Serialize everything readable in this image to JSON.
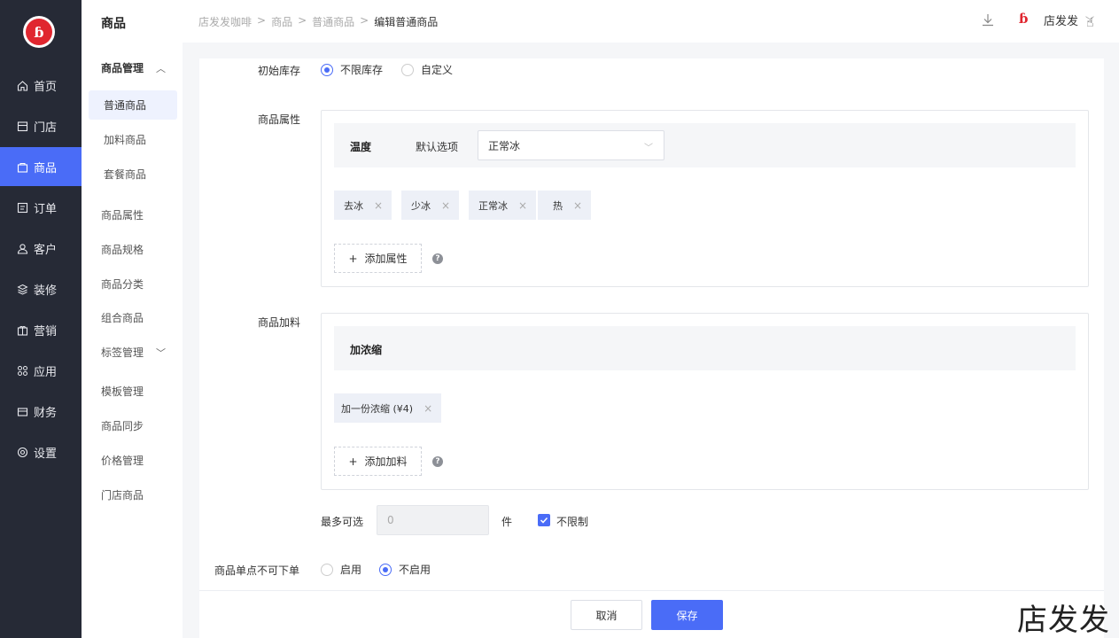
{
  "rail": {
    "items": [
      {
        "label": "首页",
        "icon": "home-icon"
      },
      {
        "label": "门店",
        "icon": "store-icon"
      },
      {
        "label": "商品",
        "icon": "bag-icon",
        "active": true
      },
      {
        "label": "订单",
        "icon": "order-icon"
      },
      {
        "label": "客户",
        "icon": "user-icon"
      },
      {
        "label": "装修",
        "icon": "layers-icon"
      },
      {
        "label": "营销",
        "icon": "gift-icon"
      },
      {
        "label": "应用",
        "icon": "apps-icon"
      },
      {
        "label": "财务",
        "icon": "wallet-icon"
      },
      {
        "label": "设置",
        "icon": "gear-icon"
      }
    ]
  },
  "sidebar": {
    "title": "商品",
    "group_manage": "商品管理",
    "sub": [
      "普通商品",
      "加料商品",
      "套餐商品"
    ],
    "items": [
      "商品属性",
      "商品规格",
      "商品分类",
      "组合商品"
    ],
    "group_tags": "标签管理",
    "items2": [
      "模板管理",
      "商品同步",
      "价格管理",
      "门店商品"
    ]
  },
  "header": {
    "breadcrumb": [
      "店发发咖啡",
      "商品",
      "普通商品",
      "编辑普通商品"
    ],
    "separator": ">",
    "user_name": "店发发"
  },
  "form": {
    "stock": {
      "label": "初始库存",
      "opt1": "不限库存",
      "opt2": "自定义"
    },
    "attr": {
      "label": "商品属性",
      "name": "温度",
      "default_label": "默认选项",
      "default_value": "正常冰",
      "tags": [
        "去冰",
        "少冰",
        "正常冰",
        "热"
      ],
      "add_label": "添加属性",
      "help": "?"
    },
    "addon": {
      "label": "商品加料",
      "name": "加浓缩",
      "tags": [
        "加一份浓缩 (¥4)"
      ],
      "add_label": "添加加料",
      "help": "?"
    },
    "max": {
      "label": "最多可选",
      "placeholder": "0",
      "unit": "件",
      "unlimited": "不限制"
    },
    "single": {
      "label": "商品单点不可下单",
      "opt1": "启用",
      "opt2": "不启用"
    }
  },
  "footer": {
    "cancel": "取消",
    "save": "保存"
  },
  "watermark": "店发发",
  "logo_text": "ɓ",
  "colors": {
    "accent": "#4a6cf7",
    "rail": "#262a36",
    "brand": "#e0262f"
  }
}
